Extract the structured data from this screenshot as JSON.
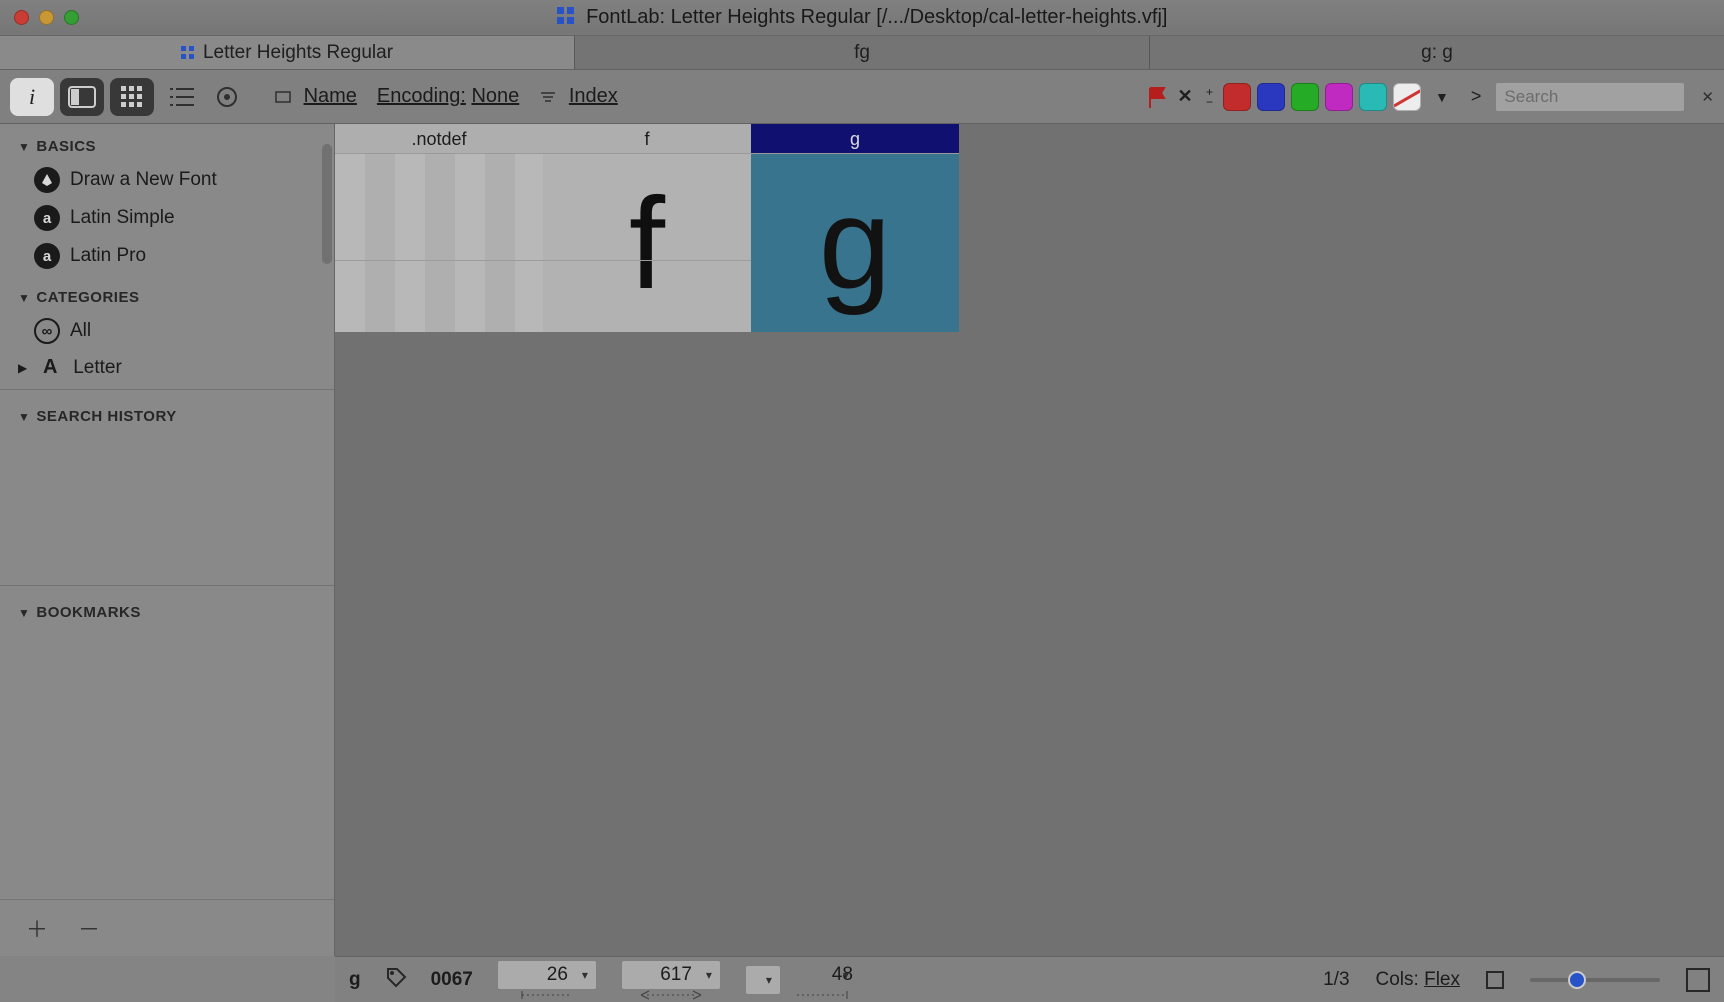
{
  "window": {
    "title_prefix": "FontLab: ",
    "title_doc": "Letter Heights Regular",
    "title_path": " [/.../Desktop/cal-letter-heights.vfj]"
  },
  "tabs": [
    {
      "label": "Letter Heights Regular",
      "active": true,
      "icon": "grid"
    },
    {
      "label": "fg",
      "active": false,
      "icon": "none"
    },
    {
      "label": "g: g",
      "active": false,
      "icon": "none",
      "glyph_suffix": true
    }
  ],
  "toolbar": {
    "name_label": "Name",
    "encoding_label": "Encoding:",
    "encoding_value": "None",
    "index_label": "Index",
    "search_placeholder": "Search"
  },
  "colors": {
    "swatches": [
      "#d23030",
      "#2e3cce",
      "#28b828",
      "#cf2ecf",
      "#2ec9c3"
    ]
  },
  "sidebar": {
    "sections": {
      "basics": {
        "title": "BASICS",
        "items": [
          {
            "icon": "pen",
            "label": "Draw a New Font"
          },
          {
            "icon": "a",
            "label": "Latin Simple"
          },
          {
            "icon": "a",
            "label": "Latin Pro"
          }
        ]
      },
      "categories": {
        "title": "CATEGORIES",
        "items": [
          {
            "icon": "inf",
            "label": "All"
          },
          {
            "icon": "A",
            "label": "Letter",
            "expandable": true
          }
        ]
      },
      "search_history": {
        "title": "SEARCH HISTORY"
      },
      "bookmarks": {
        "title": "BOOKMARKS"
      }
    }
  },
  "glyphs": [
    {
      "name": ".notdef",
      "display": "",
      "selected": false,
      "empty": true
    },
    {
      "name": "f",
      "display": "f",
      "selected": false,
      "empty": false
    },
    {
      "name": "g",
      "display": "g",
      "selected": true,
      "empty": false
    }
  ],
  "status": {
    "current_glyph": "g",
    "unicode": "0067",
    "left_sb": "26",
    "width": "617",
    "right_sb": "48",
    "position": "1/3",
    "cols_label": "Cols:",
    "cols_value": "Flex"
  }
}
